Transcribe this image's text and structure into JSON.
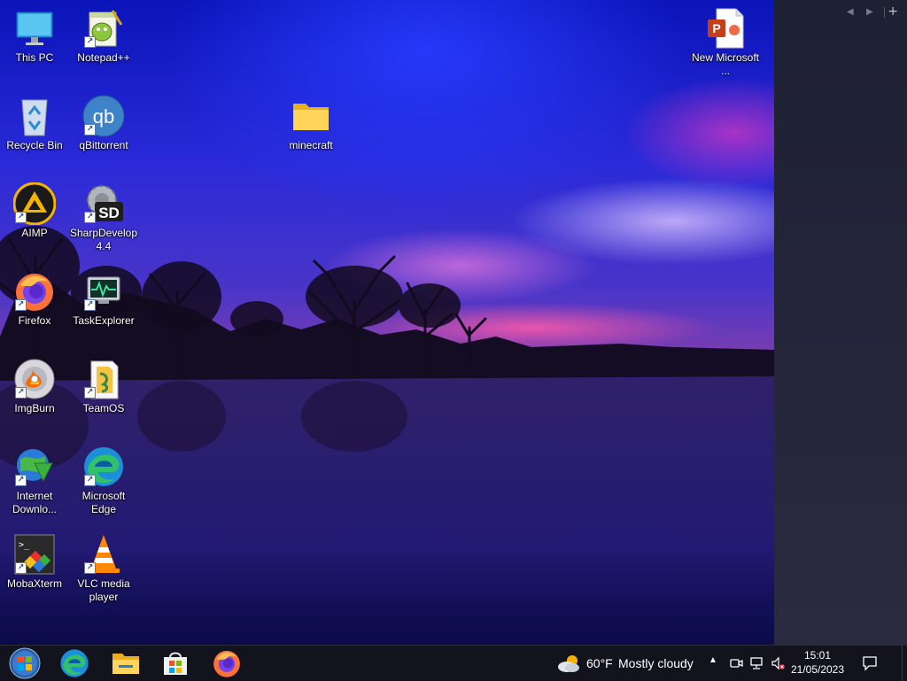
{
  "desktop": {
    "icons": [
      {
        "label": "This PC",
        "icon": "this-pc-icon"
      },
      {
        "label": "Notepad++",
        "icon": "notepad-plus-plus-icon"
      },
      {
        "label": "New Microsoft ...",
        "icon": "powerpoint-icon"
      },
      {
        "label": "Recycle Bin",
        "icon": "recycle-bin-icon"
      },
      {
        "label": "qBittorrent",
        "icon": "qbittorrent-icon"
      },
      {
        "label": "minecraft",
        "icon": "folder-icon"
      },
      {
        "label": "AIMP",
        "icon": "aimp-icon"
      },
      {
        "label": "SharpDevelop 4.4",
        "icon": "sharpdevelop-icon"
      },
      {
        "label": "Firefox",
        "icon": "firefox-icon"
      },
      {
        "label": "TaskExplorer",
        "icon": "taskexplorer-icon"
      },
      {
        "label": "ImgBurn",
        "icon": "imgburn-icon"
      },
      {
        "label": "TeamOS",
        "icon": "teamos-icon"
      },
      {
        "label": "Internet Downlo...",
        "icon": "internet-download-manager-icon"
      },
      {
        "label": "Microsoft Edge",
        "icon": "edge-icon"
      },
      {
        "label": "MobaXterm",
        "icon": "mobaxterm-icon"
      },
      {
        "label": "VLC media player",
        "icon": "vlc-icon"
      }
    ]
  },
  "sidepanel": {
    "prev_label": "◀",
    "next_label": "▶",
    "add_label": "+"
  },
  "taskbar": {
    "pinned": [
      {
        "icon": "start-orb-icon"
      },
      {
        "icon": "edge-icon"
      },
      {
        "icon": "file-explorer-icon"
      },
      {
        "icon": "microsoft-store-icon"
      },
      {
        "icon": "firefox-icon"
      }
    ],
    "weather": {
      "temperature": "60°F",
      "condition": "Mostly cloudy",
      "icon": "cloudy-icon"
    },
    "tray": {
      "chevron_label": "▲",
      "icons": [
        "meet-now-icon",
        "network-icon",
        "volume-muted-icon"
      ]
    },
    "clock": {
      "time": "15:01",
      "date": "21/05/2023"
    },
    "notifications_icon": "action-center-icon"
  },
  "colors": {
    "taskbar_bg": "#12131d",
    "sidepanel_bg": "#24253a",
    "firefox_orange": "#ff7139",
    "edge_blue": "#1c8fd8"
  }
}
